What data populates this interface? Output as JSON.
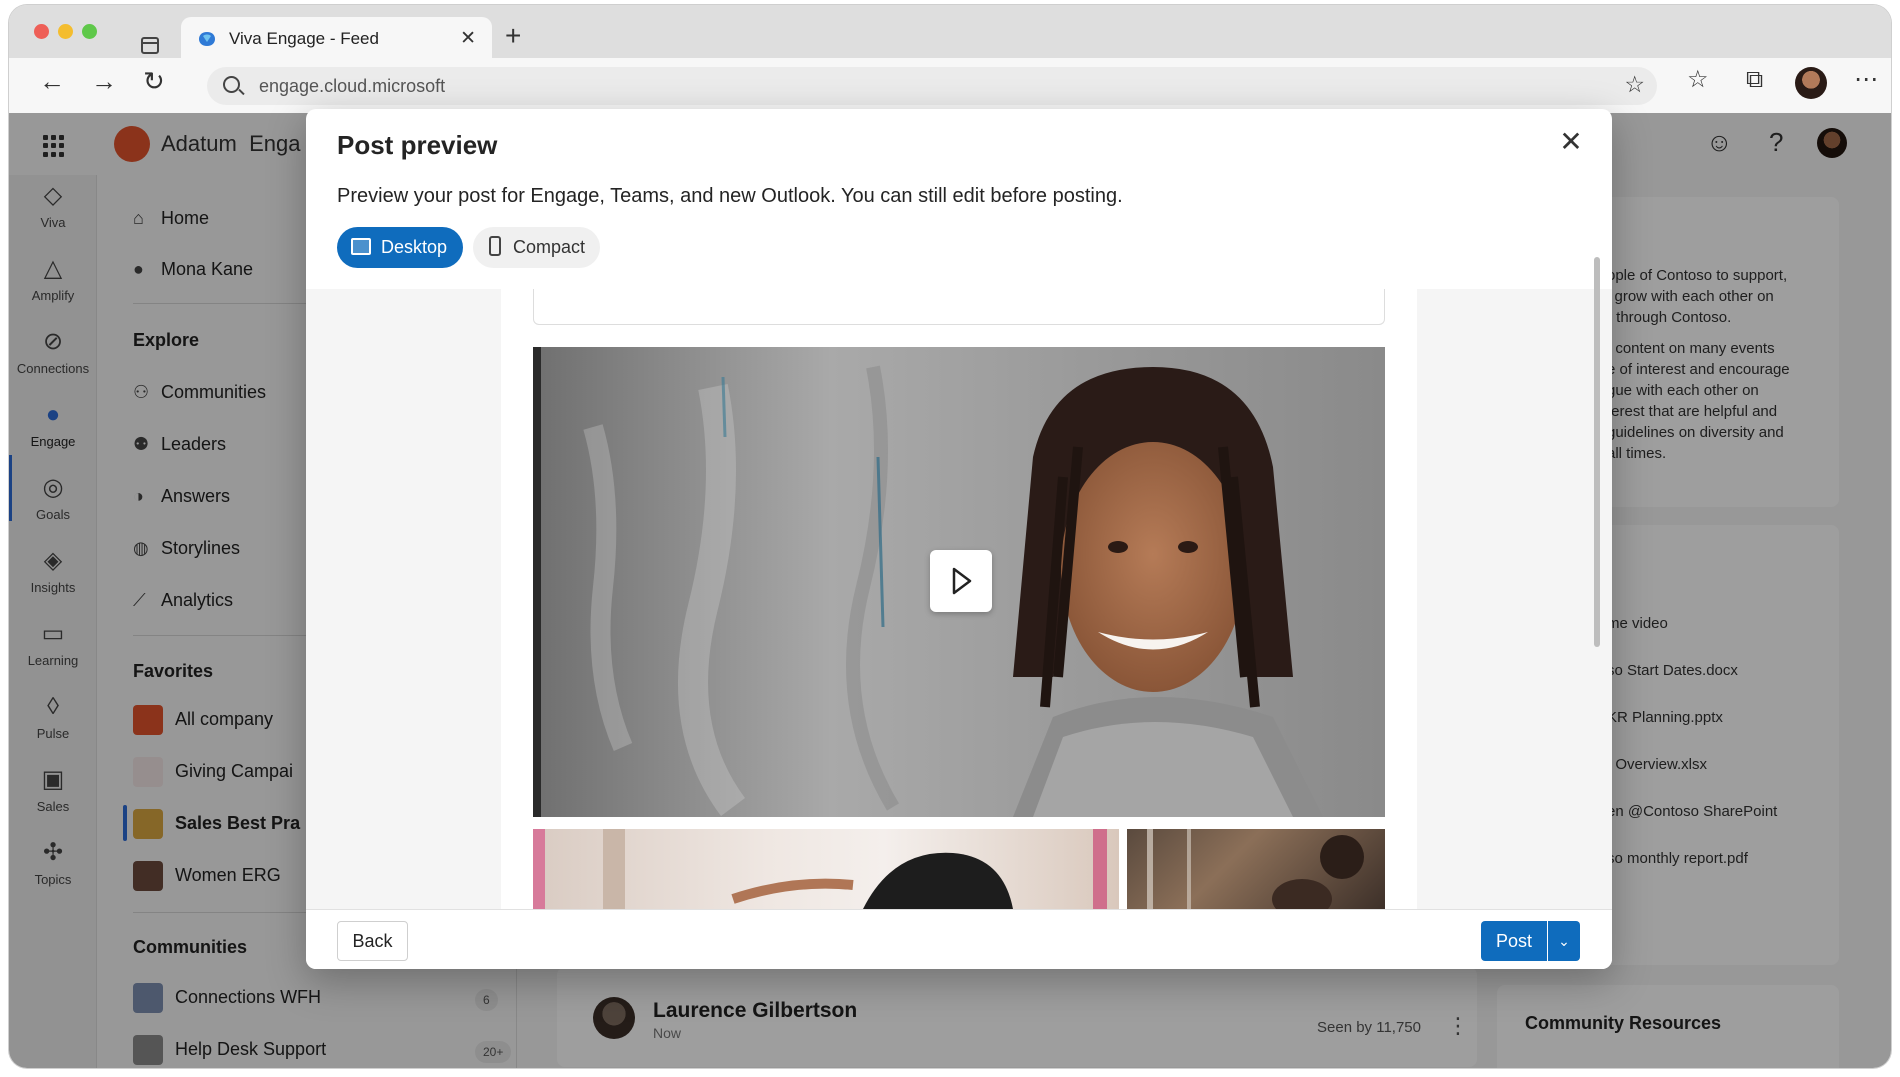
{
  "browser": {
    "tab_title": "Viva Engage - Feed",
    "tab_close": "✕",
    "new_tab": "+",
    "url": "engage.cloud.microsoft"
  },
  "app": {
    "org_name": "Adatum",
    "app_name_partial": "Enga"
  },
  "rail": {
    "items": [
      {
        "label": "Viva",
        "icon": "viva-icon"
      },
      {
        "label": "Amplify",
        "icon": "amplify-icon"
      },
      {
        "label": "Connections",
        "icon": "connections-icon"
      },
      {
        "label": "Engage",
        "icon": "engage-icon"
      },
      {
        "label": "Goals",
        "icon": "goals-icon"
      },
      {
        "label": "Insights",
        "icon": "insights-icon"
      },
      {
        "label": "Learning",
        "icon": "learning-icon"
      },
      {
        "label": "Pulse",
        "icon": "pulse-icon"
      },
      {
        "label": "Sales",
        "icon": "sales-icon"
      },
      {
        "label": "Topics",
        "icon": "topics-icon"
      }
    ]
  },
  "leftnav": {
    "home": "Home",
    "profile": "Mona Kane",
    "explore_heading": "Explore",
    "explore": [
      "Communities",
      "Leaders",
      "Answers",
      "Storylines",
      "Analytics"
    ],
    "favorites_heading": "Favorites",
    "favorites": [
      "All company",
      "Giving Campai",
      "Sales Best Pra",
      "Women ERG"
    ],
    "communities_heading": "Communities",
    "communities": [
      {
        "name": "Connections WFH",
        "badge": "6"
      },
      {
        "name": "Help Desk Support",
        "badge": "20+"
      }
    ]
  },
  "feed": {
    "post_author": "Laurence Gilbertson",
    "post_time": "Now",
    "post_seen": "Seen by 11,750"
  },
  "rightpanel": {
    "about_lines": [
      "ople of Contoso to support,",
      "l grow with each other on",
      "r through Contoso.",
      "t content on many events",
      "e of interest and encourage",
      "gue with each other on",
      "terest that are helpful and",
      "guidelines on diversity and",
      "all times."
    ],
    "files": [
      "me video",
      "so Start Dates.docx",
      "KR Planning.pptx",
      "t Overview.xlsx",
      "en @Contoso SharePoint",
      "so monthly report.pdf"
    ],
    "resources_heading": "Community Resources"
  },
  "modal": {
    "title": "Post preview",
    "description": "Preview your post for Engage, Teams, and new Outlook. You can still edit before posting.",
    "tab_desktop": "Desktop",
    "tab_compact": "Compact",
    "back_label": "Back",
    "post_label": "Post"
  }
}
